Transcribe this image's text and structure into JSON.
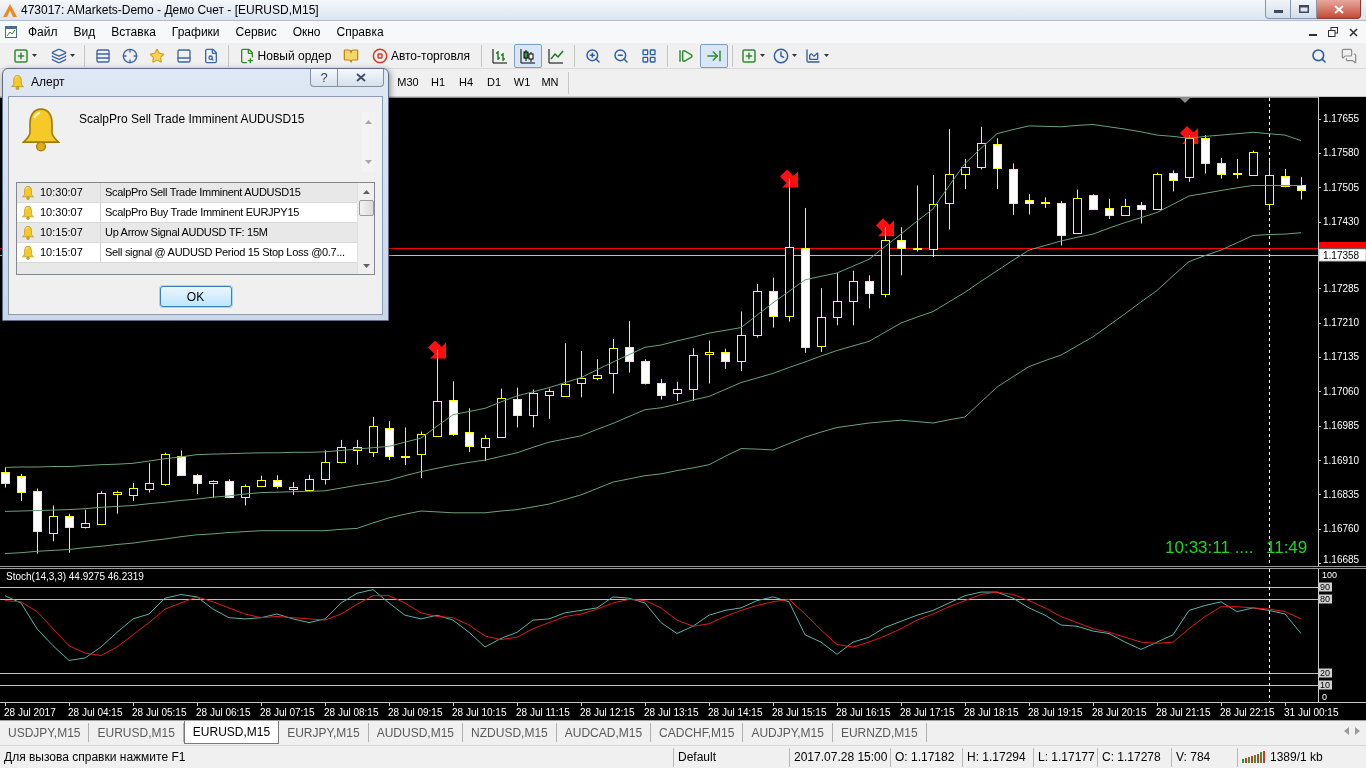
{
  "window": {
    "title": "473017: AMarkets-Demo - Демо Счет - [EURUSD,M15]"
  },
  "menu": [
    "Файл",
    "Вид",
    "Вставка",
    "Графики",
    "Сервис",
    "Окно",
    "Справка"
  ],
  "toolbar": {
    "buttons": [
      {
        "label": "Новый ордер"
      },
      {
        "label": "Авто-торговля"
      }
    ],
    "chart_types": [
      {
        "selected": false
      },
      {
        "selected": true
      },
      {
        "selected": false
      }
    ],
    "auto_scroll": {
      "on": false
    },
    "chart_shift": {
      "on": true
    }
  },
  "periods": [
    {
      "label": "M30",
      "selected": false
    },
    {
      "label": "H1",
      "selected": false
    },
    {
      "label": "H4",
      "selected": false
    },
    {
      "label": "D1",
      "selected": false
    },
    {
      "label": "W1",
      "selected": false
    },
    {
      "label": "MN",
      "selected": false
    }
  ],
  "chart": {
    "chart_data": [
      {
        "type": "candlestick",
        "ylim": [
          1.16679,
          1.17702
        ],
        "yticks": [
          {
            "value": 1.17655,
            "label": "1.17655"
          },
          {
            "value": 1.1758,
            "label": "1.17580"
          },
          {
            "value": 1.17505,
            "label": "1.17505"
          },
          {
            "value": 1.1743,
            "label": "1.17430"
          },
          {
            "value": 1.17285,
            "label": "1.17285"
          },
          {
            "value": 1.1721,
            "label": "1.17210"
          },
          {
            "value": 1.17135,
            "label": "1.17135"
          },
          {
            "value": 1.1706,
            "label": "1.17060"
          },
          {
            "value": 1.16985,
            "label": "1.16985"
          },
          {
            "value": 1.1691,
            "label": "1.16910"
          },
          {
            "value": 1.16835,
            "label": "1.16835"
          },
          {
            "value": 1.1676,
            "label": "1.16760"
          },
          {
            "value": 1.16685,
            "label": "1.16685"
          }
        ],
        "ohlc": [
          [
            1.16885,
            1.16895,
            1.1685,
            1.1686
          ],
          [
            1.16876,
            1.1688,
            1.16821,
            1.16841
          ],
          [
            1.16843,
            1.16848,
            1.16706,
            1.16756
          ],
          [
            1.16752,
            1.16811,
            1.16733,
            1.16788
          ],
          [
            1.16788,
            1.16793,
            1.16708,
            1.16764
          ],
          [
            1.16763,
            1.16802,
            1.16761,
            1.16772
          ],
          [
            1.1677,
            1.16842,
            1.16768,
            1.16839
          ],
          [
            1.16836,
            1.16843,
            1.16793,
            1.1684
          ],
          [
            1.16834,
            1.1686,
            1.16821,
            1.1685
          ],
          [
            1.16848,
            1.16903,
            1.16839,
            1.1686
          ],
          [
            1.16857,
            1.16926,
            1.16854,
            1.16923
          ],
          [
            1.1692,
            1.16931,
            1.16876,
            1.16877
          ],
          [
            1.16877,
            1.1688,
            1.16836,
            1.1686
          ],
          [
            1.1686,
            1.16866,
            1.16827,
            1.16864
          ],
          [
            1.16865,
            1.16868,
            1.16827,
            1.1683
          ],
          [
            1.1683,
            1.16857,
            1.16811,
            1.16854
          ],
          [
            1.16854,
            1.16876,
            1.16851,
            1.16866
          ],
          [
            1.16866,
            1.16877,
            1.16848,
            1.16854
          ],
          [
            1.16848,
            1.16862,
            1.16834,
            1.16852
          ],
          [
            1.16845,
            1.16878,
            1.16843,
            1.16869
          ],
          [
            1.16868,
            1.16931,
            1.16857,
            1.16905
          ],
          [
            1.16906,
            1.16954,
            1.16903,
            1.16938
          ],
          [
            1.16933,
            1.16954,
            1.169,
            1.16938
          ],
          [
            1.16928,
            1.17004,
            1.16917,
            1.16984
          ],
          [
            1.16981,
            1.16995,
            1.1691,
            1.1692
          ],
          [
            1.16917,
            1.16981,
            1.16899,
            1.1692
          ],
          [
            1.16924,
            1.16972,
            1.16871,
            1.16966
          ],
          [
            1.16963,
            1.17151,
            1.16961,
            1.17039
          ],
          [
            1.17041,
            1.17082,
            1.16963,
            1.16967
          ],
          [
            1.16972,
            1.17023,
            1.16928,
            1.1694
          ],
          [
            1.16938,
            1.16965,
            1.16908,
            1.16958
          ],
          [
            1.16961,
            1.17066,
            1.16958,
            1.17046
          ],
          [
            1.17044,
            1.17068,
            1.16981,
            1.17009
          ],
          [
            1.17009,
            1.17064,
            1.16981,
            1.17057
          ],
          [
            1.17053,
            1.17066,
            1.17,
            1.1706
          ],
          [
            1.1705,
            1.17165,
            1.17048,
            1.17076
          ],
          [
            1.17078,
            1.17148,
            1.17047,
            1.17089
          ],
          [
            1.1709,
            1.1713,
            1.17084,
            1.17096
          ],
          [
            1.17099,
            1.17174,
            1.17055,
            1.17154
          ],
          [
            1.17156,
            1.17213,
            1.17101,
            1.17126
          ],
          [
            1.17126,
            1.1713,
            1.17075,
            1.17078
          ],
          [
            1.17079,
            1.17087,
            1.17042,
            1.17052
          ],
          [
            1.17057,
            1.17081,
            1.17039,
            1.17066
          ],
          [
            1.17064,
            1.17154,
            1.17039,
            1.17139
          ],
          [
            1.17141,
            1.17171,
            1.17077,
            1.17146
          ],
          [
            1.17146,
            1.17153,
            1.17109,
            1.17126
          ],
          [
            1.17126,
            1.17234,
            1.17104,
            1.17182
          ],
          [
            1.17182,
            1.17294,
            1.17177,
            1.17278
          ],
          [
            1.17278,
            1.17308,
            1.17199,
            1.17224
          ],
          [
            1.17224,
            1.17524,
            1.17212,
            1.17375
          ],
          [
            1.17373,
            1.1746,
            1.17144,
            1.17157
          ],
          [
            1.17159,
            1.17285,
            1.17146,
            1.17222
          ],
          [
            1.17222,
            1.17318,
            1.17204,
            1.17258
          ],
          [
            1.17258,
            1.17323,
            1.17204,
            1.173
          ],
          [
            1.173,
            1.17313,
            1.17241,
            1.17275
          ],
          [
            1.17273,
            1.17418,
            1.17265,
            1.17391
          ],
          [
            1.1739,
            1.17418,
            1.17313,
            1.17373
          ],
          [
            1.1737,
            1.17509,
            1.17365,
            1.17373
          ],
          [
            1.1737,
            1.17532,
            1.17353,
            1.17468
          ],
          [
            1.17471,
            1.17632,
            1.17413,
            1.17535
          ],
          [
            1.17535,
            1.17567,
            1.17501,
            1.1755
          ],
          [
            1.1755,
            1.17637,
            1.17544,
            1.17602
          ],
          [
            1.176,
            1.17612,
            1.17501,
            1.17547
          ],
          [
            1.17544,
            1.17557,
            1.17445,
            1.1747
          ],
          [
            1.17478,
            1.1749,
            1.17446,
            1.17471
          ],
          [
            1.17473,
            1.17483,
            1.1746,
            1.17474
          ],
          [
            1.17471,
            1.17475,
            1.17378,
            1.174
          ],
          [
            1.17405,
            1.175,
            1.17403,
            1.17481
          ],
          [
            1.17488,
            1.1749,
            1.17456,
            1.17458
          ],
          [
            1.1746,
            1.1748,
            1.17436,
            1.17445
          ],
          [
            1.17445,
            1.1748,
            1.17443,
            1.17465
          ],
          [
            1.17466,
            1.17473,
            1.17426,
            1.17458
          ],
          [
            1.17458,
            1.17537,
            1.17456,
            1.17535
          ],
          [
            1.17537,
            1.17542,
            1.17496,
            1.17522
          ],
          [
            1.17527,
            1.17619,
            1.17517,
            1.17612
          ],
          [
            1.17612,
            1.17619,
            1.17535,
            1.17557
          ],
          [
            1.17557,
            1.17569,
            1.17524,
            1.17535
          ],
          [
            1.17535,
            1.17567,
            1.17524,
            1.17536
          ],
          [
            1.17532,
            1.17585,
            1.1753,
            1.17582
          ],
          [
            1.17468,
            1.17562,
            1.17455,
            1.17532
          ],
          [
            1.17529,
            1.17545,
            1.17505,
            1.17507
          ],
          [
            1.1751,
            1.17527,
            1.17478,
            1.175
          ]
        ],
        "series": [
          {
            "type": "line",
            "color": "#6aa17c",
            "values": [
              1.16894,
              1.16895,
              1.16895,
              1.16896,
              1.16896,
              1.16898,
              1.169,
              1.16901,
              1.16903,
              1.16908,
              1.16913,
              1.16917,
              1.16922,
              1.16923,
              1.16924,
              1.16925,
              1.16926,
              1.16926,
              1.16927,
              1.16927,
              1.16928,
              1.16931,
              1.16934,
              1.16937,
              1.1694,
              1.16949,
              1.16958,
              1.16984,
              1.17009,
              1.17016,
              1.17023,
              1.17037,
              1.1705,
              1.17059,
              1.17068,
              1.17079,
              1.1709,
              1.17107,
              1.17124,
              1.1714,
              1.17156,
              1.17161,
              1.1717,
              1.17178,
              1.17187,
              1.17193,
              1.17199,
              1.17226,
              1.17253,
              1.17278,
              1.17303,
              1.17311,
              1.17318,
              1.17333,
              1.17348,
              1.17376,
              1.17403,
              1.17431,
              1.17458,
              1.17508,
              1.17557,
              1.1759,
              1.17622,
              1.17631,
              1.17639,
              1.17638,
              1.17637,
              1.1764,
              1.17642,
              1.17637,
              1.17632,
              1.17626,
              1.17619,
              1.17616,
              1.17612,
              1.17616,
              1.17619,
              1.17622,
              1.17625,
              1.17622,
              1.17619,
              1.17607
            ]
          },
          {
            "type": "line",
            "color": "#6aa17c",
            "values": [
              1.16798,
              1.16799,
              1.168,
              1.16801,
              1.16802,
              1.16804,
              1.16807,
              1.16809,
              1.16811,
              1.16815,
              1.16818,
              1.16822,
              1.16825,
              1.16829,
              1.16832,
              1.16836,
              1.16839,
              1.1684,
              1.16841,
              1.16842,
              1.16843,
              1.16849,
              1.16855,
              1.1686,
              1.16866,
              1.16876,
              1.16885,
              1.16892,
              1.16899,
              1.16905,
              1.1691,
              1.16918,
              1.16926,
              1.16938,
              1.16949,
              1.16956,
              1.16963,
              1.16977,
              1.1699,
              1.17005,
              1.1702,
              1.17024,
              1.17032,
              1.17041,
              1.17049,
              1.17064,
              1.17079,
              1.17089,
              1.17099,
              1.17112,
              1.17124,
              1.17137,
              1.17149,
              1.17159,
              1.17169,
              1.17189,
              1.17209,
              1.17222,
              1.17234,
              1.17255,
              1.17276,
              1.173,
              1.17323,
              1.17346,
              1.17368,
              1.17378,
              1.17388,
              1.17396,
              1.17403,
              1.17416,
              1.17428,
              1.17439,
              1.1745,
              1.17468,
              1.17486,
              1.17492,
              1.17498,
              1.17504,
              1.17509,
              1.17509,
              1.17509,
              1.17509
            ]
          },
          {
            "type": "line",
            "color": "#6aa17c",
            "values": [
              1.16706,
              1.16708,
              1.16711,
              1.16713,
              1.16715,
              1.16719,
              1.16722,
              1.16726,
              1.16729,
              1.16734,
              1.16738,
              1.16743,
              1.16747,
              1.16749,
              1.16752,
              1.16754,
              1.16756,
              1.16756,
              1.16756,
              1.16756,
              1.16756,
              1.16759,
              1.16761,
              1.16773,
              1.16784,
              1.16792,
              1.16799,
              1.16797,
              1.16795,
              1.16795,
              1.16795,
              1.16799,
              1.16802,
              1.16808,
              1.16814,
              1.16824,
              1.16834,
              1.16848,
              1.16862,
              1.16869,
              1.16876,
              1.1688,
              1.16887,
              1.16893,
              1.169,
              1.16918,
              1.16935,
              1.16934,
              1.16932,
              1.16946,
              1.1696,
              1.16971,
              1.16981,
              1.16986,
              1.16991,
              1.16994,
              1.16997,
              1.16994,
              1.16991,
              1.16998,
              1.17004,
              1.17037,
              1.17069,
              1.17092,
              1.17114,
              1.17127,
              1.17139,
              1.17159,
              1.17179,
              1.17204,
              1.17229,
              1.17255,
              1.1728,
              1.17312,
              1.17343,
              1.17356,
              1.17368,
              1.17384,
              1.174,
              1.17402,
              1.17403,
              1.17406
            ]
          }
        ],
        "ref_lines": [
          {
            "axis": "y",
            "value": 1.17373,
            "color": "#ff0000"
          },
          {
            "axis": "y",
            "value": 1.17358,
            "label": "1.17358",
            "color": "#c0c0c0"
          }
        ]
      },
      {
        "type": "line",
        "title": "Stoch(14,3,3) 44.9275 46.2319",
        "ylim": [
          -4.1,
          104.9
        ],
        "yticks": [
          0,
          100
        ],
        "series": [
          {
            "color": "#55b5a8",
            "values": [
              83,
              77,
              56,
              42,
              30,
              32,
              41,
              53,
              64,
              68,
              81,
              84,
              82,
              72,
              65,
              64,
              65,
              68,
              64,
              61,
              64,
              77,
              85,
              88,
              77,
              67,
              64,
              67,
              63,
              53,
              41,
              48,
              53,
              63,
              64,
              69,
              71,
              73,
              82,
              81,
              77,
              61,
              52,
              58,
              67,
              71,
              73,
              79,
              82,
              78,
              51,
              45,
              35,
              45,
              49,
              57,
              62,
              67,
              71,
              77,
              83,
              86,
              86,
              81,
              73,
              67,
              59,
              58,
              54,
              52,
              45,
              39,
              45,
              51,
              71,
              75,
              78,
              70,
              73,
              71,
              68,
              52
            ]
          },
          {
            "color": "#e01b1b",
            "values": [
              79,
              78,
              70,
              56,
              42,
              36,
              34,
              41,
              51,
              61,
              72,
              77,
              82,
              78,
              73,
              68,
              65,
              66,
              65,
              64,
              63,
              68,
              76,
              83,
              83,
              77,
              69,
              66,
              65,
              59,
              50,
              47,
              49,
              56,
              61,
              66,
              68,
              72,
              77,
              80,
              79,
              73,
              63,
              58,
              60,
              66,
              71,
              75,
              78,
              80,
              68,
              55,
              43,
              41,
              45,
              50,
              56,
              63,
              68,
              74,
              79,
              84,
              86,
              84,
              79,
              73,
              66,
              61,
              56,
              53,
              49,
              45,
              44,
              45,
              56,
              66,
              74,
              74,
              73,
              72,
              70,
              64
            ]
          }
        ],
        "ref_lines": [
          {
            "axis": "y",
            "value": 90,
            "label": "90",
            "color": "#c0c0c0"
          },
          {
            "axis": "y",
            "value": 80,
            "label": "80",
            "color": "#c0c0c0"
          },
          {
            "axis": "y",
            "value": 20,
            "label": "20",
            "color": "#c0c0c0"
          },
          {
            "axis": "y",
            "value": 10,
            "label": "10",
            "color": "#c0c0c0"
          }
        ]
      }
    ],
    "time_axis": [
      "28 Jul 2017",
      "28 Jul 04:15",
      "28 Jul 05:15",
      "28 Jul 06:15",
      "28 Jul 07:15",
      "28 Jul 08:15",
      "28 Jul 09:15",
      "28 Jul 10:15",
      "28 Jul 11:15",
      "28 Jul 12:15",
      "28 Jul 13:15",
      "28 Jul 14:15",
      "28 Jul 15:15",
      "28 Jul 16:15",
      "28 Jul 17:15",
      "28 Jul 18:15",
      "28 Jul 19:15",
      "28 Jul 20:15",
      "28 Jul 21:15",
      "28 Jul 22:15",
      "31 Jul 00:15"
    ],
    "overlay_text": [
      "10:33:11 ....",
      "11:49"
    ]
  },
  "symbol_tabs": [
    {
      "label": "USDJPY,M15",
      "selected": false
    },
    {
      "label": "EURUSD,M15",
      "selected": false
    },
    {
      "label": "EURUSD,M15",
      "selected": true
    },
    {
      "label": "EURJPY,M15",
      "selected": false
    },
    {
      "label": "AUDUSD,M15",
      "selected": false
    },
    {
      "label": "NZDUSD,M15",
      "selected": false
    },
    {
      "label": "AUDCAD,M15",
      "selected": false
    },
    {
      "label": "CADCHF,M15",
      "selected": false
    },
    {
      "label": "AUDJPY,M15",
      "selected": false
    },
    {
      "label": "EURNZD,M15",
      "selected": false
    }
  ],
  "status_bar": {
    "fields": [
      {
        "kind": "text",
        "text": "Для вызова справки нажмите F1"
      },
      {
        "kind": "text",
        "text": "Default"
      },
      {
        "kind": "text",
        "text": "2017.07.28 15:00"
      },
      {
        "kind": "text",
        "text": "O: 1.17182"
      },
      {
        "kind": "text",
        "text": "H: 1.17294"
      },
      {
        "kind": "text",
        "text": "L: 1.17177"
      },
      {
        "kind": "text",
        "text": "C: 1.17278"
      },
      {
        "kind": "text",
        "text": "V: 784"
      },
      {
        "kind": "traffic",
        "text": "1389/1 kb"
      }
    ]
  },
  "alert_dialog": {
    "title": "Алерт",
    "help_button": "?",
    "message": "ScalpPro Sell Trade Imminent AUDUSD15",
    "alerts": [
      {
        "time": "10:30:07",
        "message": "ScalpPro Sell Trade Imminent AUDUSD15"
      },
      {
        "time": "10:30:07",
        "message": "ScalpPro Buy Trade Imminent EURJPY15"
      },
      {
        "time": "10:15:07",
        "message": "Up Arrow Signal AUDUSD TF: 15M"
      },
      {
        "time": "10:15:07",
        "message": "Sell signal @ AUDUSD Period 15 Stop Loss @0.7..."
      }
    ],
    "ok_button": "OK"
  }
}
